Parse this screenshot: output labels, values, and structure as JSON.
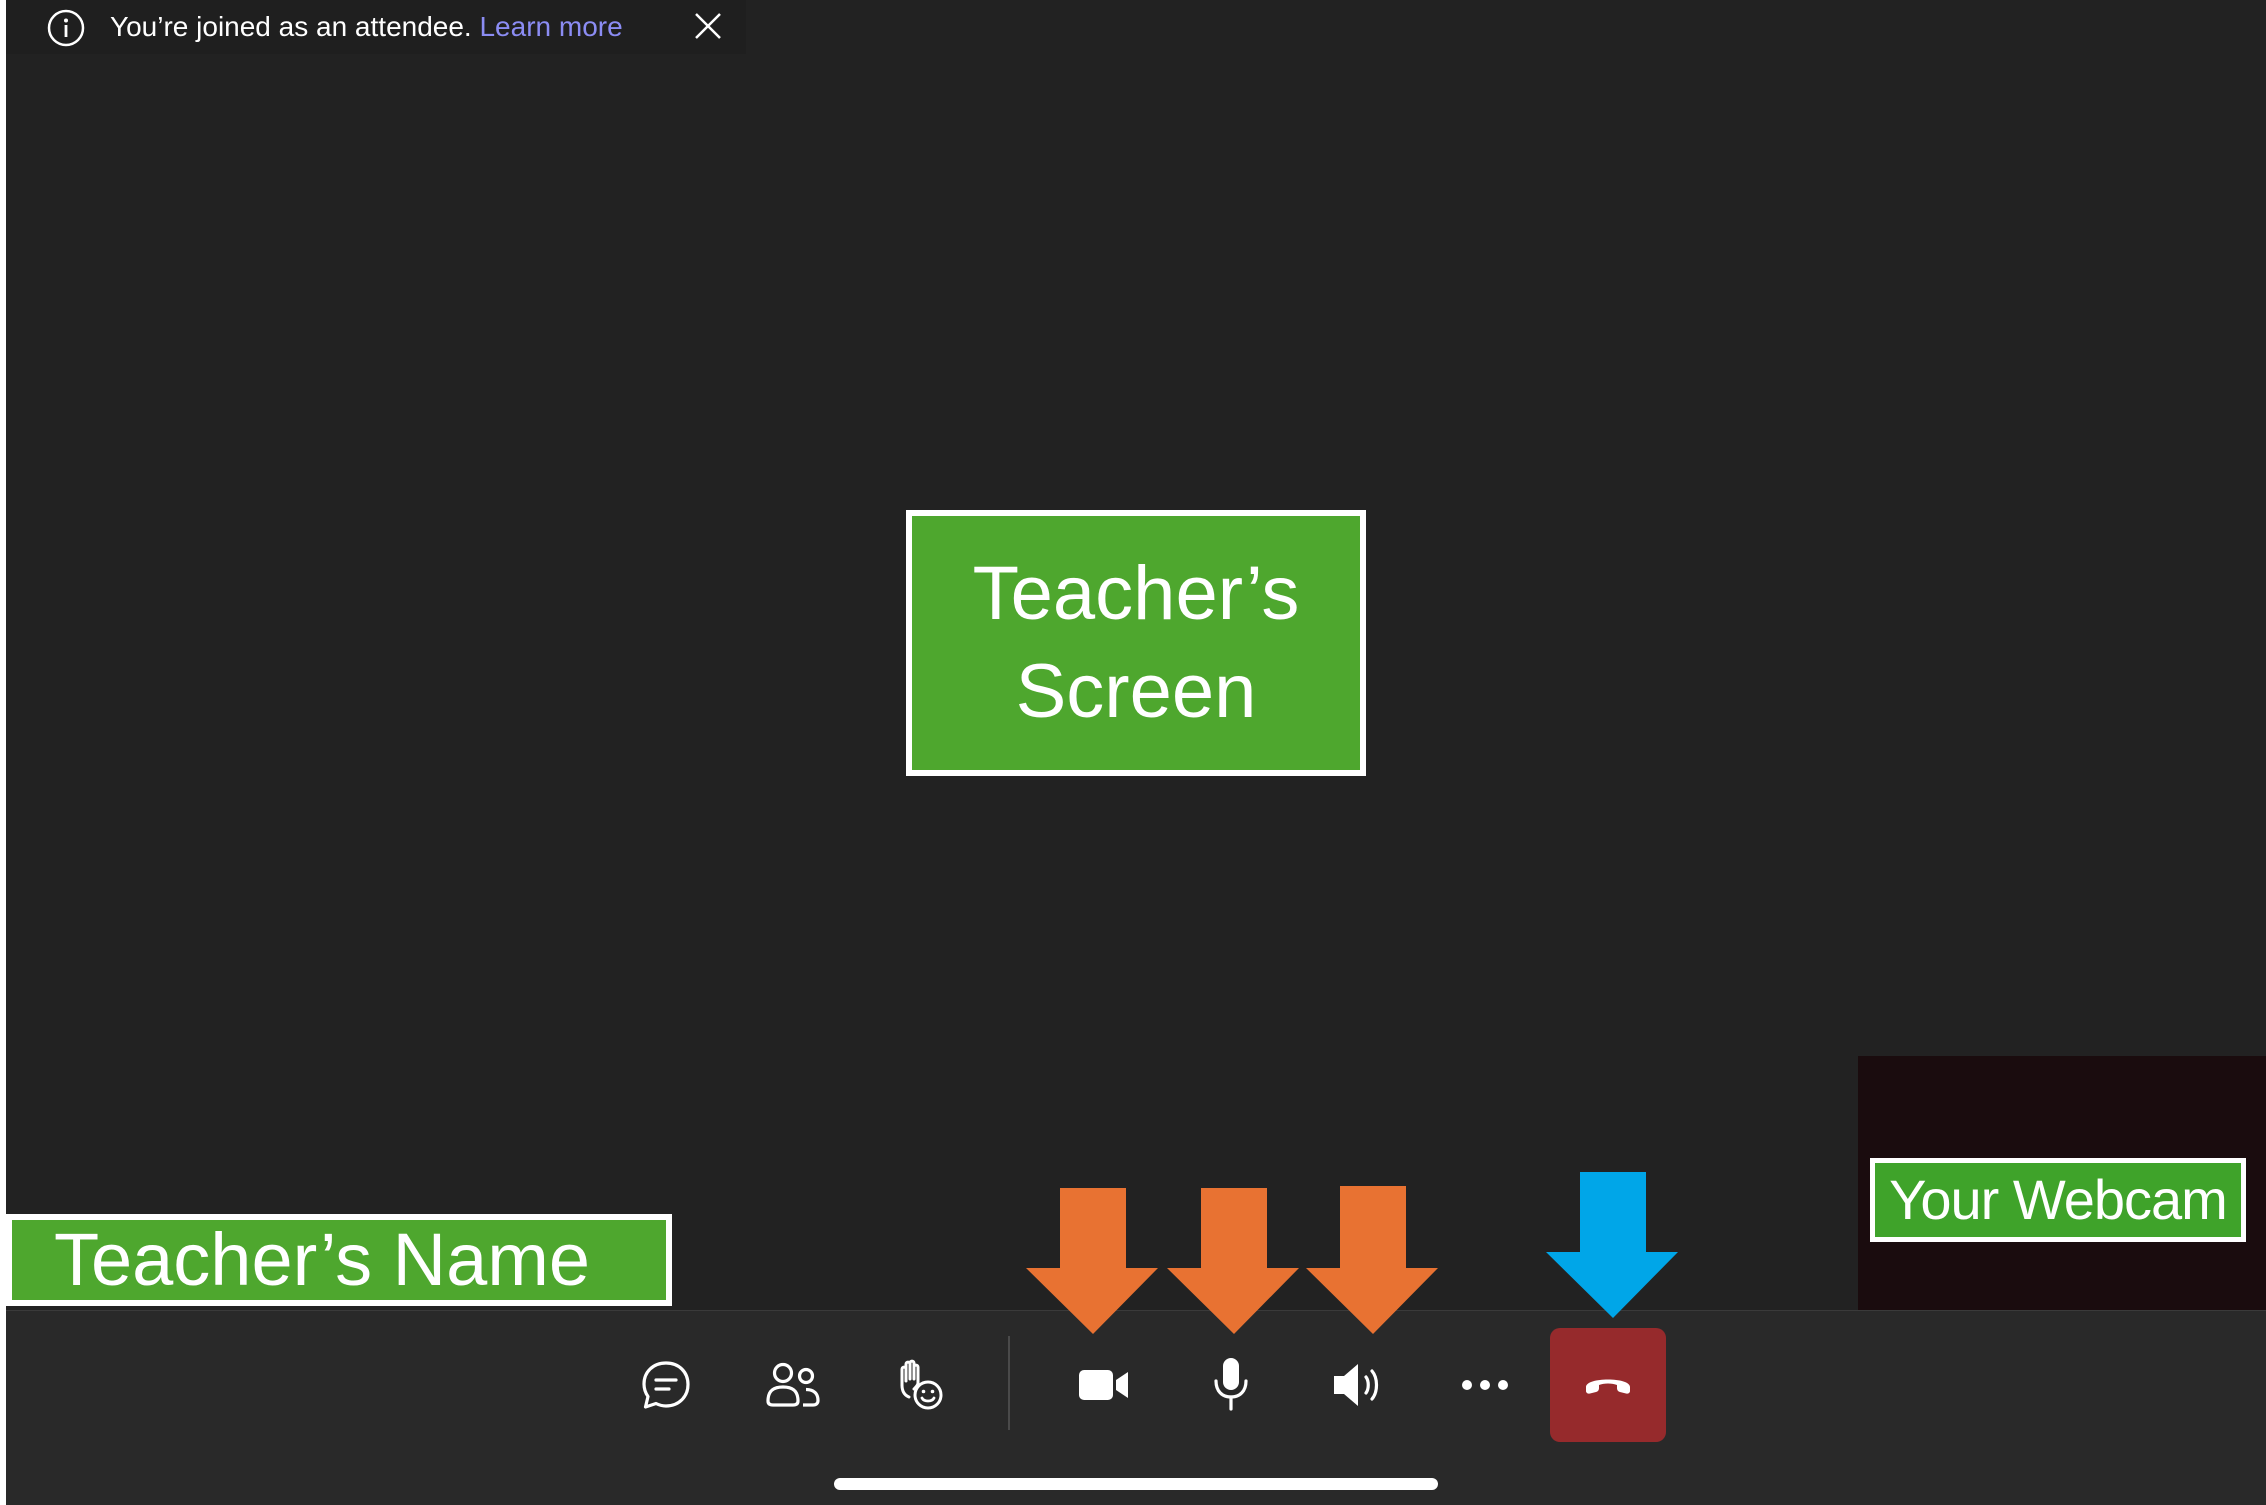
{
  "banner": {
    "message": "You’re joined as an attendee.",
    "link": "Learn more",
    "icons": {
      "info": "info-icon",
      "close": "close-icon"
    }
  },
  "stage": {
    "screen_label_line1": "Teacher’s",
    "screen_label_line2": "Screen",
    "name_label": "Teacher’s Name"
  },
  "webcam": {
    "label": "Your Webcam"
  },
  "toolbar": {
    "buttons": [
      {
        "name": "chat",
        "icon": "chat-icon"
      },
      {
        "name": "participants",
        "icon": "people-icon"
      },
      {
        "name": "reactions",
        "icon": "raise-hand-icon"
      },
      {
        "name": "camera",
        "icon": "video-camera-icon"
      },
      {
        "name": "microphone",
        "icon": "microphone-icon"
      },
      {
        "name": "speaker",
        "icon": "speaker-icon"
      },
      {
        "name": "more",
        "icon": "more-icon"
      },
      {
        "name": "leave",
        "icon": "hang-up-icon"
      }
    ]
  },
  "colors": {
    "background": "#222222",
    "toolbar": "#292929",
    "label_green": "#4ea72e",
    "link": "#8b8cf3",
    "hangup": "#962a2c",
    "arrow_orange": "#e87232",
    "arrow_blue": "#00a6e8"
  }
}
